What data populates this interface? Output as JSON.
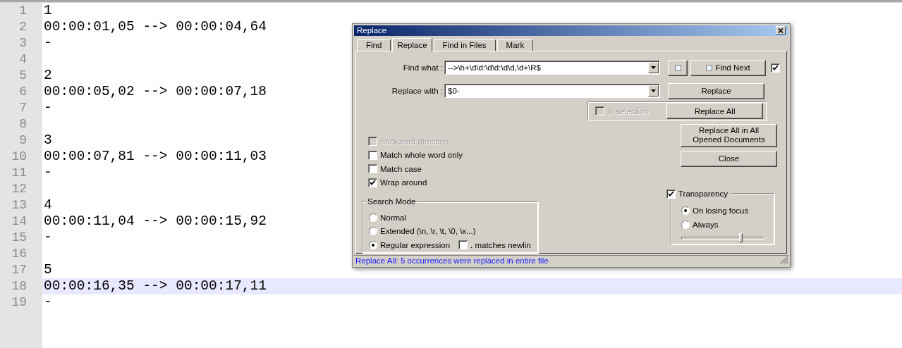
{
  "editor": {
    "lines": [
      {
        "number": "1",
        "text": "1",
        "current": false
      },
      {
        "number": "2",
        "text": "00:00:01,05 --> 00:00:04,64",
        "current": false
      },
      {
        "number": "3",
        "text": "-",
        "current": false
      },
      {
        "number": "4",
        "current": false
      },
      {
        "number": "5",
        "text": "2",
        "current": false
      },
      {
        "number": "6",
        "text": "00:00:05,02 --> 00:00:07,18",
        "current": false
      },
      {
        "number": "7",
        "text": "-",
        "current": false
      },
      {
        "number": "8",
        "current": false
      },
      {
        "number": "9",
        "text": "3",
        "current": false
      },
      {
        "number": "10",
        "text": "00:00:07,81 --> 00:00:11,03",
        "current": false
      },
      {
        "number": "11",
        "text": "-",
        "current": false
      },
      {
        "number": "12",
        "current": false
      },
      {
        "number": "13",
        "text": "4",
        "current": false
      },
      {
        "number": "14",
        "text": "00:00:11,04 --> 00:00:15,92",
        "current": false
      },
      {
        "number": "15",
        "text": "-",
        "current": false
      },
      {
        "number": "16",
        "current": false
      },
      {
        "number": "17",
        "text": "5",
        "current": false
      },
      {
        "number": "18",
        "text": "00:00:16,35 --> 00:00:17,11",
        "current": true
      },
      {
        "number": "19",
        "text": "-",
        "current": false
      }
    ]
  },
  "dialog": {
    "title": "Replace",
    "tabs": [
      {
        "label": "Find",
        "selected": false
      },
      {
        "label": "Replace",
        "selected": true
      },
      {
        "label": "Find in Files",
        "selected": false
      },
      {
        "label": "Mark",
        "selected": false
      }
    ],
    "find_what": {
      "label": "Find what :",
      "value": "-->\\h+\\d\\d:\\d\\d:\\d\\d,\\d+\\R$"
    },
    "replace_with": {
      "label": "Replace with :",
      "value": "$0-"
    },
    "find_next_button": "Find Next",
    "find_next_checkbox": {
      "checked": true
    },
    "replace_button": "Replace",
    "in_selection": {
      "label": "In selection",
      "checked": false,
      "disabled": true
    },
    "replace_all_button": "Replace All",
    "replace_all_open_button": "Replace All in All Opened Documents",
    "close_button": "Close",
    "options": [
      {
        "label": "Backward direction",
        "checked": false,
        "disabled": true
      },
      {
        "label": "Match whole word only",
        "checked": false,
        "disabled": false
      },
      {
        "label": "Match case",
        "checked": false,
        "disabled": false
      },
      {
        "label": "Wrap around",
        "checked": true,
        "disabled": false
      }
    ],
    "search_mode": {
      "title": "Search Mode",
      "options": [
        {
          "label": "Normal",
          "selected": false
        },
        {
          "label": "Extended (\\n, \\r, \\t, \\0, \\x...)",
          "selected": false
        },
        {
          "label": "Regular expression",
          "selected": true
        }
      ],
      "newline_option": {
        "label": ". matches newlin",
        "checked": false
      }
    },
    "transparency": {
      "label": "Transparency",
      "checked": true,
      "options": [
        {
          "label": "On losing focus",
          "selected": true
        },
        {
          "label": "Always",
          "selected": false
        }
      ],
      "level": 0.71
    },
    "status": "Replace All: 5 occurrences were replaced in entire file"
  }
}
